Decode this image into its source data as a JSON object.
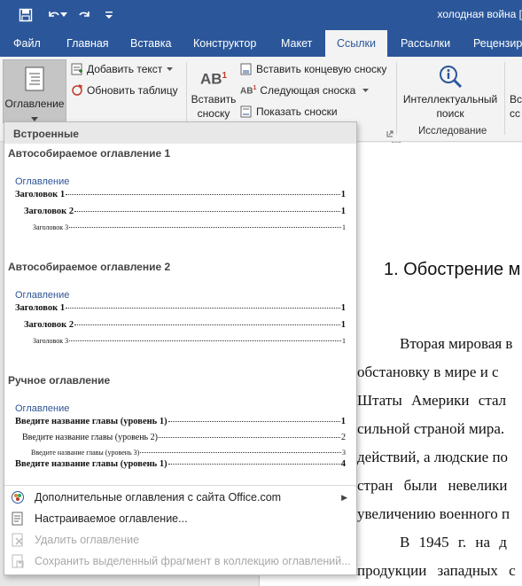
{
  "window": {
    "title": "холодная война ["
  },
  "tabs": [
    {
      "label": "Файл",
      "active": false
    },
    {
      "label": "Главная",
      "active": false
    },
    {
      "label": "Вставка",
      "active": false
    },
    {
      "label": "Конструктор",
      "active": false
    },
    {
      "label": "Макет",
      "active": false
    },
    {
      "label": "Ссылки",
      "active": true
    },
    {
      "label": "Рассылки",
      "active": false
    },
    {
      "label": "Рецензиро",
      "active": false
    }
  ],
  "ribbon": {
    "toc_button": "Оглавление",
    "add_text": "Добавить текст",
    "update_table": "Обновить таблицу",
    "insert_footnote_line1": "Вставить",
    "insert_footnote_line2": "сноску",
    "insert_endnote": "Вставить концевую сноску",
    "next_footnote": "Следующая сноска",
    "show_notes": "Показать сноски",
    "smart_lookup_line1": "Интеллектуальный",
    "smart_lookup_line2": "поиск",
    "research_group": "Исследование",
    "cut_line1": "Вс",
    "cut_line2": "сс"
  },
  "dropdown": {
    "header": "Встроенные",
    "galleries": [
      {
        "title": "Автособираемое оглавление 1",
        "heading": "Оглавление",
        "lines": [
          {
            "label": "Заголовок 1",
            "page": "1"
          },
          {
            "label": "Заголовок 2",
            "page": "1"
          },
          {
            "label": "Заголовок 3",
            "page": "1"
          }
        ]
      },
      {
        "title": "Автособираемое оглавление 2",
        "heading": "Оглавление",
        "lines": [
          {
            "label": "Заголовок 1",
            "page": "1"
          },
          {
            "label": "Заголовок 2",
            "page": "1"
          },
          {
            "label": "Заголовок 3",
            "page": "1"
          }
        ]
      },
      {
        "title": "Ручное оглавление",
        "heading": "Оглавление",
        "lines": [
          {
            "label": "Введите название главы (уровень 1)",
            "page": "1"
          },
          {
            "label": "Введите название главы (уровень 2)",
            "page": "2"
          },
          {
            "label": "Введите название главы (уровень 3)",
            "page": "3"
          },
          {
            "label": "Введите название главы (уровень 1)",
            "page": "4"
          }
        ]
      }
    ],
    "menu": [
      {
        "label": "Дополнительные оглавления с сайта Office.com",
        "disabled": false,
        "submenu": true,
        "icon": "office-gallery-icon"
      },
      {
        "label": "Настраиваемое оглавление...",
        "disabled": false,
        "submenu": false,
        "icon": "toc-settings-icon"
      },
      {
        "label": "Удалить оглавление",
        "disabled": true,
        "submenu": false,
        "icon": "remove-toc-icon"
      },
      {
        "label": "Сохранить выделенный фрагмент в коллекцию оглавлений...",
        "disabled": true,
        "submenu": false,
        "icon": "save-selection-icon"
      }
    ]
  },
  "document": {
    "heading": "1. Обострение м",
    "lines": [
      "Вторая мировая в",
      "обстановку в мире и с",
      "Штаты Америки стал",
      "сильной страной мира.",
      "действий, а людские по",
      "стран были невелики",
      "увеличению военного п",
      "В 1945 г. на д",
      "продукции западных с"
    ]
  }
}
